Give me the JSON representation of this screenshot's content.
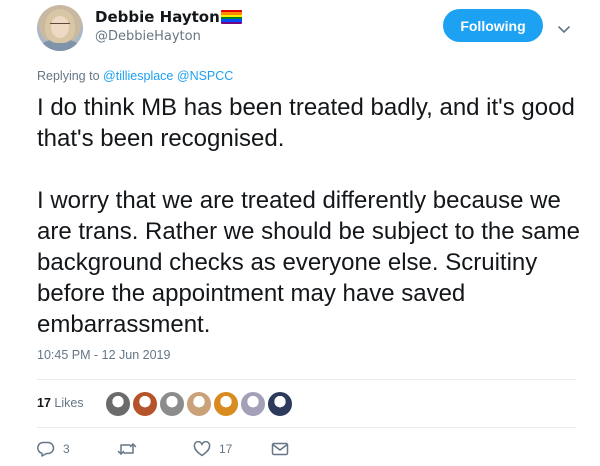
{
  "author": {
    "display_name": "Debbie Hayton",
    "handle": "@DebbieHayton",
    "badge": "rainbow-flag-icon",
    "flag_colors": [
      "#e40303",
      "#ff8c00",
      "#ffed00",
      "#008026",
      "#004dff",
      "#750787"
    ]
  },
  "follow_button": {
    "label": "Following"
  },
  "reply_context": {
    "prefix": "Replying to",
    "mentions": [
      "@tilliesplace",
      "@NSPCC"
    ]
  },
  "tweet": {
    "paragraphs": [
      "I do think MB has been treated badly, and it's good that's been recognised.",
      "I worry that we are treated differently because we are trans. Rather we should be subject to the same background checks as everyone else. Scruitiny before the appointment may have saved embarrassment."
    ],
    "timestamp": "10:45 PM - 12 Jun 2019"
  },
  "stats": {
    "likes_count": "17",
    "likes_label": "Likes",
    "liker_avatar_colors": [
      "#6b6b6b",
      "#b5532a",
      "#8c8c8c",
      "#c9a27a",
      "#d98b1f",
      "#a3a0b8",
      "#2d3a5c"
    ]
  },
  "actions": {
    "reply_count": "3",
    "retweet_count": "",
    "like_count": "17"
  },
  "colors": {
    "accent": "#1da1f2",
    "muted": "#657786",
    "text": "#14171a",
    "divider": "#e6ecf0"
  }
}
